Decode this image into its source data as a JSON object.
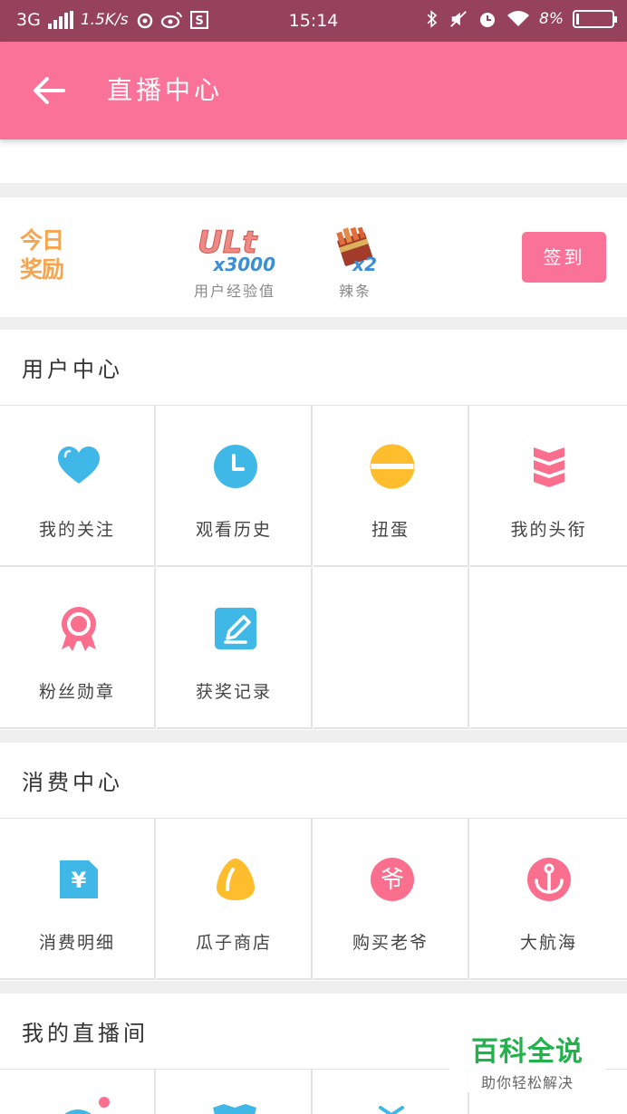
{
  "status_bar": {
    "network": "3G",
    "speed": "1.5K/s",
    "time": "15:14",
    "battery": "8%"
  },
  "app_bar": {
    "title": "直播中心"
  },
  "reward": {
    "logo_line1": "今日",
    "logo_line2": "奖励",
    "items": [
      {
        "image_text": "ULt",
        "multiplier": "x3000",
        "label": "用户经验值"
      },
      {
        "image_text": "",
        "multiplier": "x2",
        "label": "辣条"
      }
    ],
    "checkin_label": "签到"
  },
  "user_center": {
    "title": "用户中心",
    "items": [
      {
        "label": "我的关注",
        "icon": "heart-icon",
        "color": "#3fb8e8"
      },
      {
        "label": "观看历史",
        "icon": "clock-icon",
        "color": "#3fb8e8"
      },
      {
        "label": "扭蛋",
        "icon": "capsule-icon",
        "color": "#fdbd2c"
      },
      {
        "label": "我的头衔",
        "icon": "chevrons-icon",
        "color": "#fb6f8e"
      },
      {
        "label": "粉丝勋章",
        "icon": "medal-icon",
        "color": "#fb6f8e"
      },
      {
        "label": "获奖记录",
        "icon": "edit-icon",
        "color": "#3fb8e8"
      }
    ]
  },
  "consume_center": {
    "title": "消费中心",
    "items": [
      {
        "label": "消费明细",
        "icon": "yuan-bill-icon",
        "color": "#3fb8e8"
      },
      {
        "label": "瓜子商店",
        "icon": "seed-icon",
        "color": "#fdbd2c"
      },
      {
        "label": "购买老爷",
        "icon": "laoye-icon",
        "glyph": "爷",
        "color": "#fb6f8e"
      },
      {
        "label": "大航海",
        "icon": "anchor-icon",
        "color": "#fb6f8e"
      }
    ]
  },
  "my_room": {
    "title": "我的直播间"
  },
  "watermark": {
    "title": "百科全说",
    "subtitle": "助你轻松解决"
  },
  "colors": {
    "status_bar": "#97425c",
    "accent": "#fb7299",
    "blue": "#3fb8e8",
    "yellow": "#fdbd2c"
  }
}
